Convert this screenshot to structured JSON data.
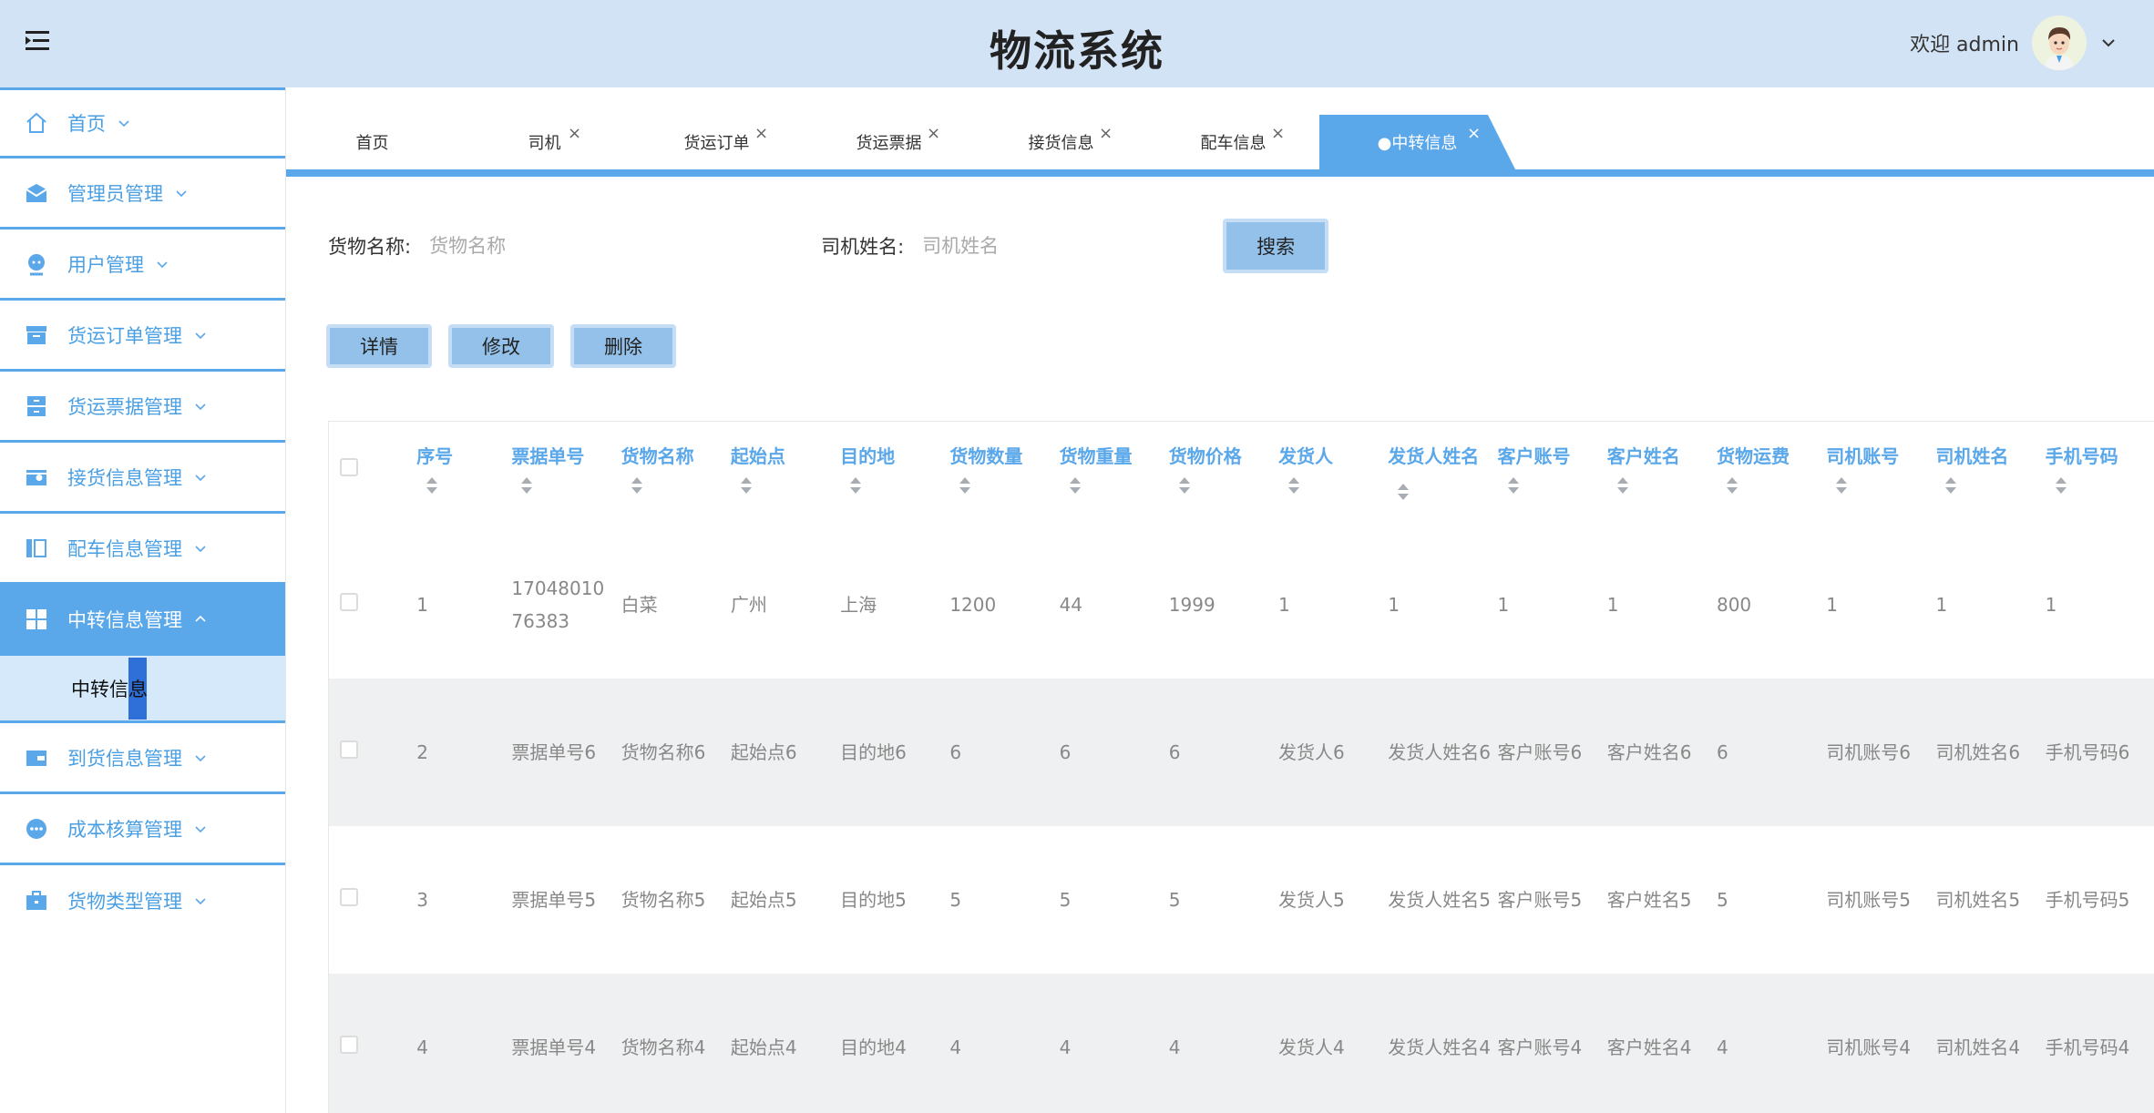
{
  "header": {
    "title": "物流系统",
    "welcome": "欢迎 admin"
  },
  "sidebar": {
    "items": [
      {
        "label": "首页",
        "icon": "home-icon"
      },
      {
        "label": "管理员管理",
        "icon": "envelope-icon"
      },
      {
        "label": "用户管理",
        "icon": "user-icon"
      },
      {
        "label": "货运订单管理",
        "icon": "box-icon"
      },
      {
        "label": "货运票据管理",
        "icon": "drawer-icon"
      },
      {
        "label": "接货信息管理",
        "icon": "wallet-icon"
      },
      {
        "label": "配车信息管理",
        "icon": "columns-icon"
      },
      {
        "label": "中转信息管理",
        "icon": "grid-icon"
      },
      {
        "label": "到货信息管理",
        "icon": "card-icon"
      },
      {
        "label": "成本核算管理",
        "icon": "dots-icon"
      },
      {
        "label": "货物类型管理",
        "icon": "briefcase-icon"
      }
    ],
    "active_sub": "中转信息"
  },
  "tabs": [
    {
      "label": "首页",
      "closable": false
    },
    {
      "label": "司机",
      "closable": true
    },
    {
      "label": "货运订单",
      "closable": true
    },
    {
      "label": "货运票据",
      "closable": true
    },
    {
      "label": "接货信息",
      "closable": true
    },
    {
      "label": "配车信息",
      "closable": true
    },
    {
      "label": "●中转信息",
      "closable": true
    }
  ],
  "tab_close_glyph": "×",
  "search": {
    "field1_label": "货物名称:",
    "field1_placeholder": "货物名称",
    "field2_label": "司机姓名:",
    "field2_placeholder": "司机姓名",
    "button": "搜索"
  },
  "actions": {
    "detail": "详情",
    "edit": "修改",
    "delete": "删除"
  },
  "table": {
    "headers": [
      "序号",
      "票据单号",
      "货物名称",
      "起始点",
      "目的地",
      "货物数量",
      "货物重量",
      "货物价格",
      "发货人",
      "发货人姓名",
      "客户账号",
      "客户姓名",
      "货物运费",
      "司机账号",
      "司机姓名",
      "手机号码"
    ],
    "rows": [
      [
        "1",
        "1704801076383",
        "白菜",
        "广州",
        "上海",
        "1200",
        "44",
        "1999",
        "1",
        "1",
        "1",
        "1",
        "800",
        "1",
        "1",
        "1"
      ],
      [
        "2",
        "票据单号6",
        "货物名称6",
        "起始点6",
        "目的地6",
        "6",
        "6",
        "6",
        "发货人6",
        "发货人姓名6",
        "客户账号6",
        "客户姓名6",
        "6",
        "司机账号6",
        "司机姓名6",
        "手机号码6"
      ],
      [
        "3",
        "票据单号5",
        "货物名称5",
        "起始点5",
        "目的地5",
        "5",
        "5",
        "5",
        "发货人5",
        "发货人姓名5",
        "客户账号5",
        "客户姓名5",
        "5",
        "司机账号5",
        "司机姓名5",
        "手机号码5"
      ],
      [
        "4",
        "票据单号4",
        "货物名称4",
        "起始点4",
        "目的地4",
        "4",
        "4",
        "4",
        "发货人4",
        "发货人姓名4",
        "客户账号4",
        "客户姓名4",
        "4",
        "司机账号4",
        "司机姓名4",
        "手机号码4"
      ]
    ]
  },
  "colors": {
    "accent": "#5aa7ea",
    "header_bg": "#d3e3f6",
    "button_bg": "#93c1ea",
    "alt_row": "#eff0f1"
  }
}
